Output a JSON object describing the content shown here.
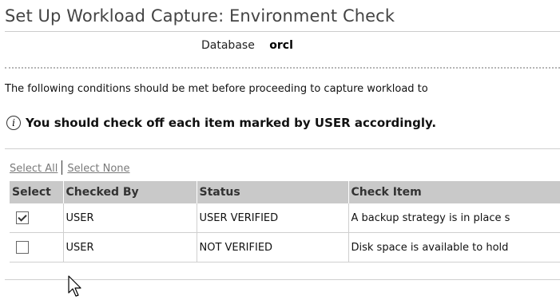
{
  "page": {
    "title": "Set Up Workload Capture: Environment Check",
    "database_label": "Database",
    "database_value": "orcl",
    "intro_text": "The following conditions should be met before proceeding to capture workload to",
    "info_message": "You should check off each item marked by USER accordingly.",
    "info_icon": "info-icon"
  },
  "selection": {
    "select_all": "Select All",
    "select_none": "Select None"
  },
  "table": {
    "headers": [
      "Select",
      "Checked By",
      "Status",
      "Check Item"
    ],
    "rows": [
      {
        "checked": true,
        "checked_by": "USER",
        "status": "USER VERIFIED",
        "check_item": "A backup strategy is in place s"
      },
      {
        "checked": false,
        "checked_by": "USER",
        "status": "NOT VERIFIED",
        "check_item": "Disk space is available to hold"
      }
    ]
  },
  "colors": {
    "title_text": "#444444",
    "header_bg": "#c9c9c9",
    "link_text": "#7a7a7a"
  }
}
